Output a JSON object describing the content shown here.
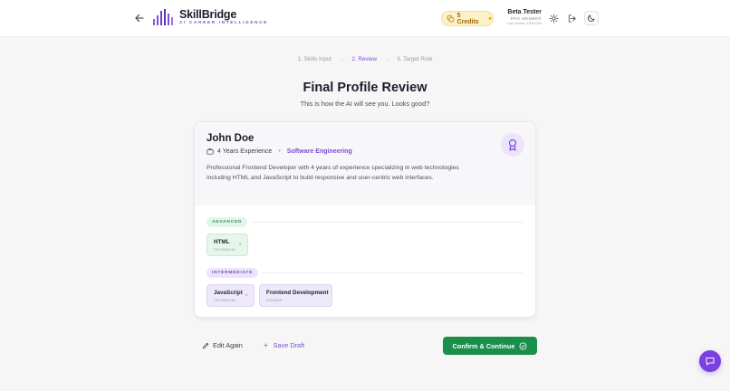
{
  "header": {
    "brand_name": "SkillBridge",
    "brand_tagline": "AI CAREER INTELLIGENCE",
    "credits_label": "5 Credits",
    "user_name": "Beta Tester",
    "user_role": "PRO MEMBER",
    "last_visited": "Last Visited: 3/30/2026",
    "accent_color": "#7c4dd8"
  },
  "steps": [
    {
      "label": "1. Skills Input",
      "state": "done"
    },
    {
      "label": "2. Review",
      "state": "active"
    },
    {
      "label": "3. Target Role",
      "state": "pending"
    }
  ],
  "page": {
    "title": "Final Profile Review",
    "subtitle": "This is how the AI will see you. Looks good?"
  },
  "profile": {
    "name": "John Doe",
    "experience": "4 Years Experience",
    "field": "Software Engineering",
    "summary": "Professional Frontend Developer with 4 years of experience specializing in web technologies including HTML and JavaScript to build responsive and user-centric web interfaces."
  },
  "skill_groups": [
    {
      "level": "ADVANCED",
      "skills": [
        {
          "name": "HTML",
          "type": "TECHNICAL"
        }
      ]
    },
    {
      "level": "INTERMEDIATE",
      "skills": [
        {
          "name": "JavaScript",
          "type": "TECHNICAL"
        },
        {
          "name": "Frontend Development",
          "type": "DOMAIN"
        }
      ]
    }
  ],
  "actions": {
    "edit_label": "Edit Again",
    "draft_label": "Save Draft",
    "confirm_label": "Confirm & Continue",
    "confirm_color": "#1a8f4a"
  },
  "icons": [
    "back-arrow-icon",
    "logo-bars-icon",
    "coin-icon",
    "sparkle-icon",
    "gear-icon",
    "logout-icon",
    "moon-icon",
    "briefcase-icon",
    "award-icon",
    "remove-icon",
    "pencil-icon",
    "plus-icon",
    "check-circle-icon",
    "chat-icon"
  ]
}
